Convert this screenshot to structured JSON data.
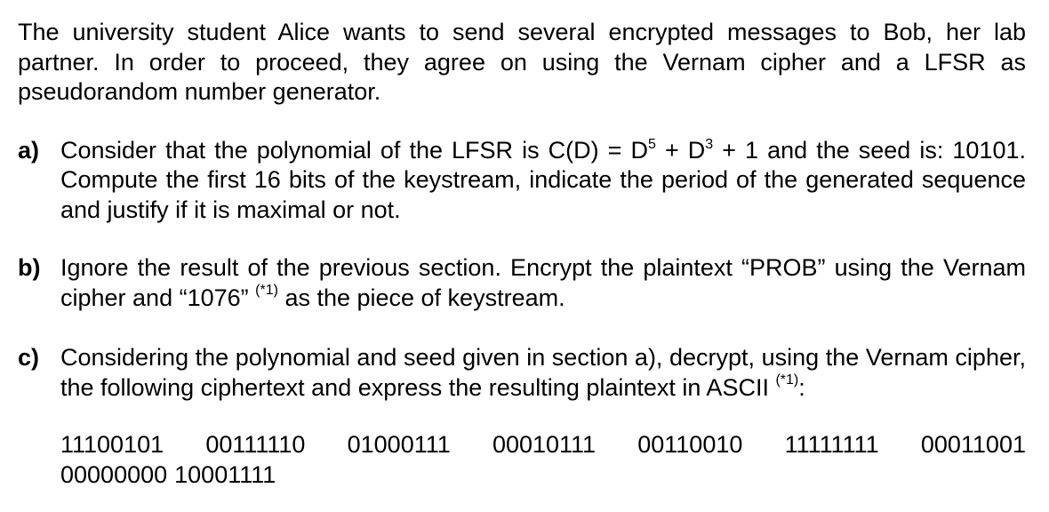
{
  "intro": "The university student Alice wants to send several encrypted messages to Bob, her lab partner. In order to proceed, they agree on using the Vernam cipher and a LFSR as pseudorandom number generator.",
  "items": [
    {
      "marker": "a)",
      "text_1": "Consider that the polynomial of the LFSR is C(D) = D",
      "exp_1": "5",
      "text_2": " + D",
      "exp_2": "3",
      "text_3": " + 1 and the seed is: 10101. Compute the first 16 bits of the keystream, indicate the period of the generated sequence and justify if it is maximal or not."
    },
    {
      "marker": "b)",
      "text_1": "Ignore the result of the previous section. Encrypt the plaintext “PROB” using the Vernam cipher and “1076”",
      "note": "(*1)",
      "text_2": " as the piece of keystream."
    },
    {
      "marker": "c)",
      "text_1": "Considering the polynomial and seed given in section a), decrypt, using the Vernam cipher, the following ciphertext and express the resulting plaintext in ASCII",
      "note": "(*1)",
      "text_2": ":"
    }
  ],
  "ciphertext": {
    "row1": [
      "11100101",
      "00111110",
      "01000111",
      "00010111",
      "00110010",
      "11111111",
      "00011001"
    ],
    "row2": [
      "00000000",
      "10001111"
    ]
  }
}
